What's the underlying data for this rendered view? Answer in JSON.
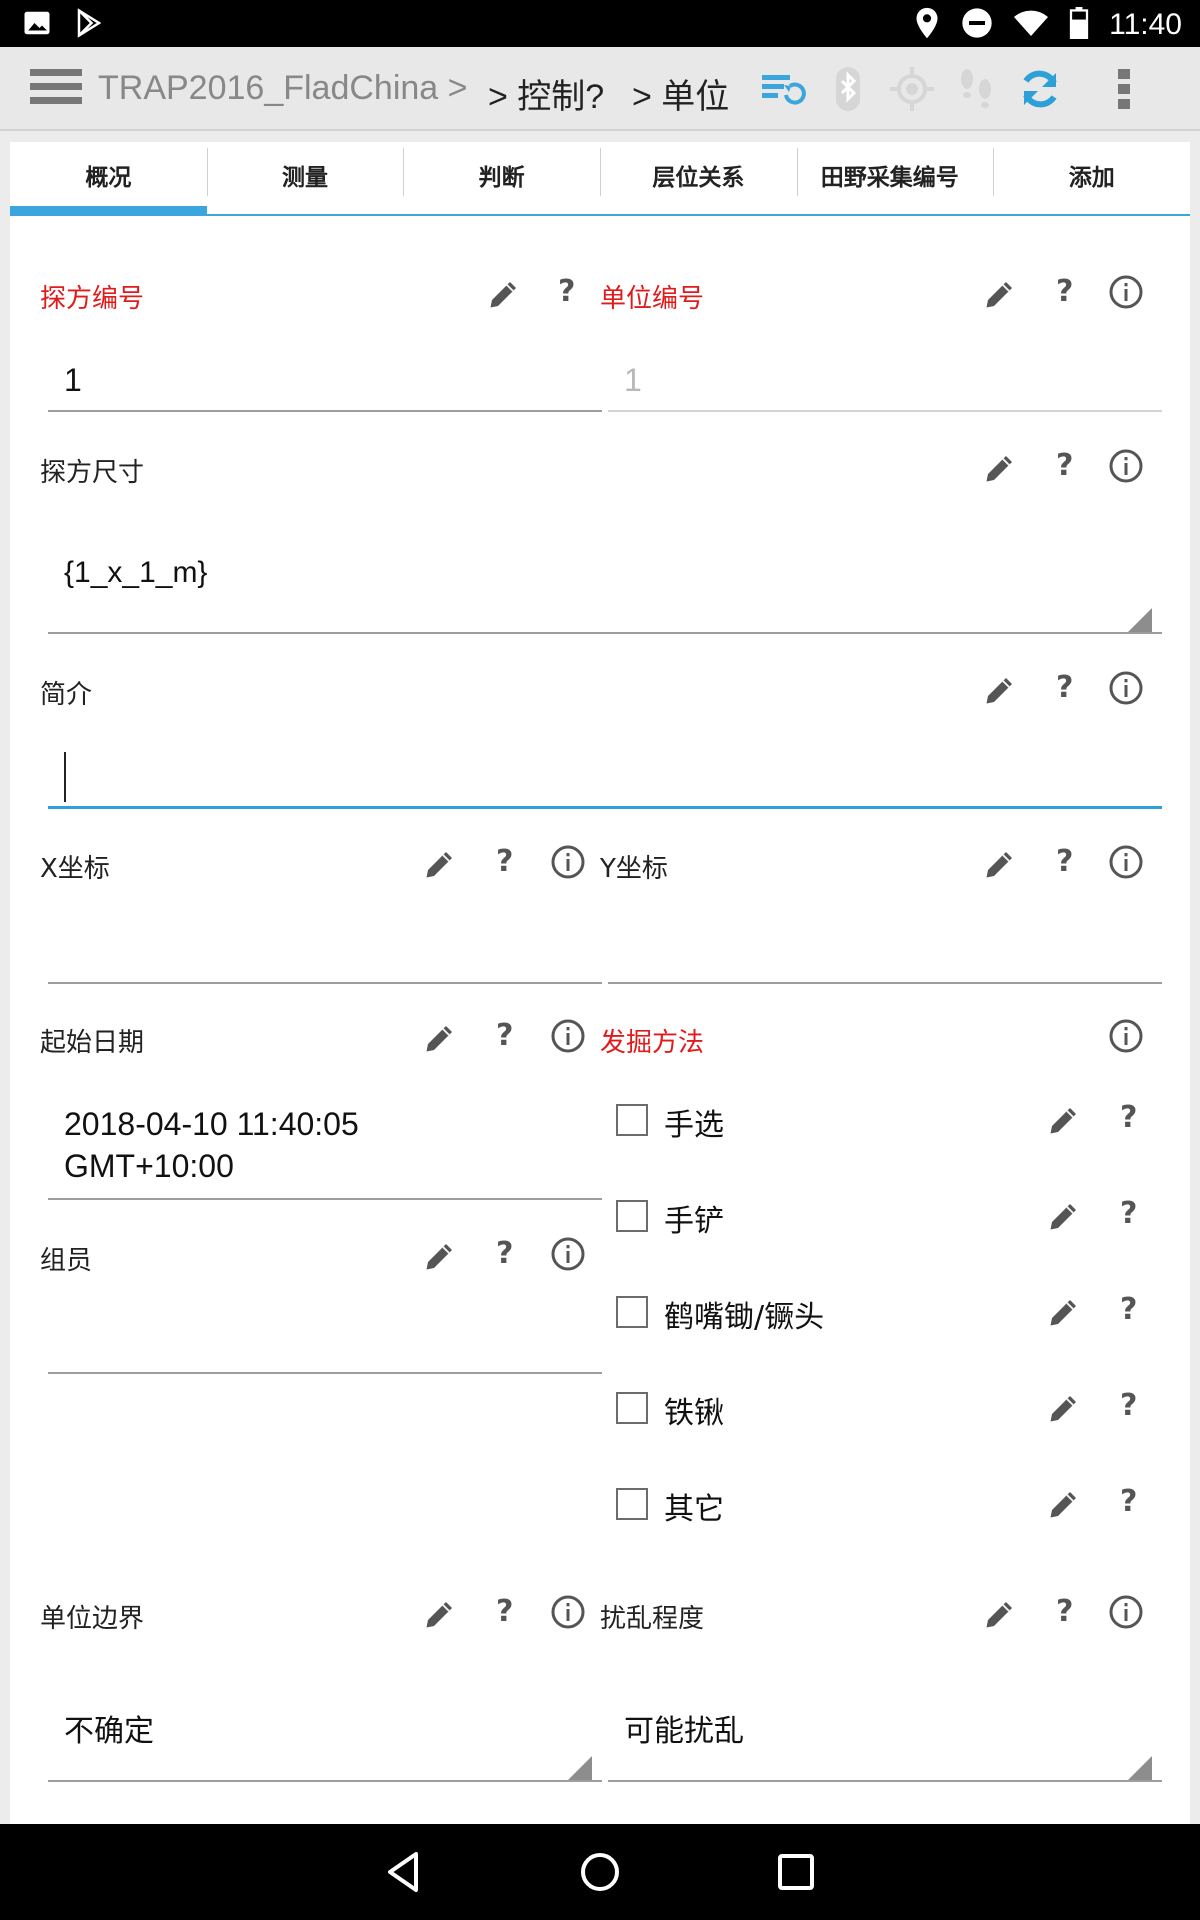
{
  "status_bar": {
    "time": "11:40",
    "left_icons": [
      "image-icon",
      "play-store-icon"
    ],
    "right_icons": [
      "location-icon",
      "dnd-icon",
      "wifi-icon",
      "battery-icon"
    ]
  },
  "app_bar": {
    "crumb1": "TRAP2016_FladChina >",
    "crumb2": "> 控制?",
    "crumb3": "> 单位",
    "icons": [
      "menu-icon",
      "sync-settings-icon",
      "bluetooth-icon",
      "gps-icon",
      "footsteps-icon",
      "refresh-icon",
      "overflow-menu-icon"
    ]
  },
  "tabs": [
    {
      "label": "概况",
      "active": true
    },
    {
      "label": "测量"
    },
    {
      "label": "判断"
    },
    {
      "label": "层位关系"
    },
    {
      "label": "田野采集编号"
    },
    {
      "label": "添加"
    }
  ],
  "fields": {
    "trench_no": {
      "label": "探方编号",
      "value": "1"
    },
    "unit_no": {
      "label": "单位编号",
      "value": "1"
    },
    "trench_size": {
      "label": "探方尺寸",
      "value": "{1_x_1_m}"
    },
    "summary": {
      "label": "简介",
      "value": ""
    },
    "x_coord": {
      "label": "X坐标",
      "value": ""
    },
    "y_coord": {
      "label": "Y坐标",
      "value": ""
    },
    "start_date": {
      "label": "起始日期",
      "value_line1": "2018-04-10 11:40:05",
      "value_line2": "GMT+10:00"
    },
    "excavation_method": {
      "label": "发掘方法",
      "options": [
        "手选",
        "手铲",
        "鹤嘴锄/镢头",
        "铁锹",
        "其它"
      ]
    },
    "members": {
      "label": "组员",
      "value": ""
    },
    "unit_boundary": {
      "label": "单位边界",
      "value": "不确定"
    },
    "disturbance": {
      "label": "扰乱程度",
      "value": "可能扰乱"
    }
  },
  "help_mark": "?",
  "colors": {
    "required": "#e01b1b",
    "accent": "#3aa6dd",
    "focus_line": "#2da0d8"
  }
}
